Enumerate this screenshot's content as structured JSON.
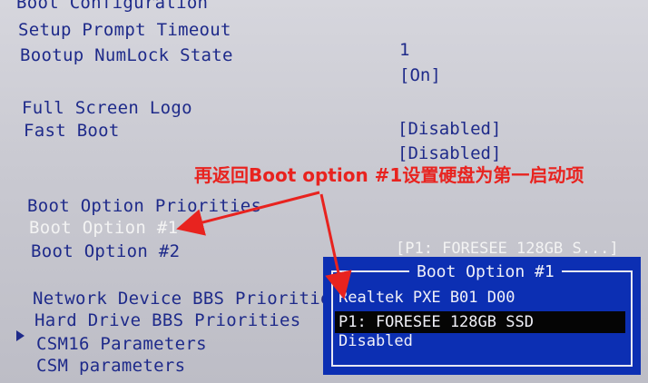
{
  "section_title": "Boot Configuration",
  "settings": [
    {
      "label": "Setup Prompt Timeout",
      "value": "1"
    },
    {
      "label": "Bootup NumLock State",
      "value": "[On]"
    },
    {
      "label": "Full Screen Logo",
      "value": "[Disabled]"
    },
    {
      "label": "Fast Boot",
      "value": "[Disabled]"
    }
  ],
  "priorities_heading": "Boot Option Priorities",
  "boot_options": [
    {
      "label": "Boot Option #1",
      "value": ""
    },
    {
      "label": "Boot Option #2",
      "value": "[P1: FORESEE 128GB S...]"
    }
  ],
  "submenus": [
    "Network Device BBS Priorities",
    "Hard Drive BBS Priorities",
    "CSM16 Parameters",
    "CSM parameters"
  ],
  "popup": {
    "title": "Boot Option #1",
    "options": [
      "Realtek PXE B01 D00",
      "P1: FORESEE 128GB SSD",
      "Disabled"
    ],
    "selected_index": 1
  },
  "annotation": "再返回Boot option #1设置硬盘为第一启动项",
  "colors": {
    "text": "#1e2a8a",
    "popup_bg": "#0c2fb3",
    "annotation": "#e8231f"
  }
}
